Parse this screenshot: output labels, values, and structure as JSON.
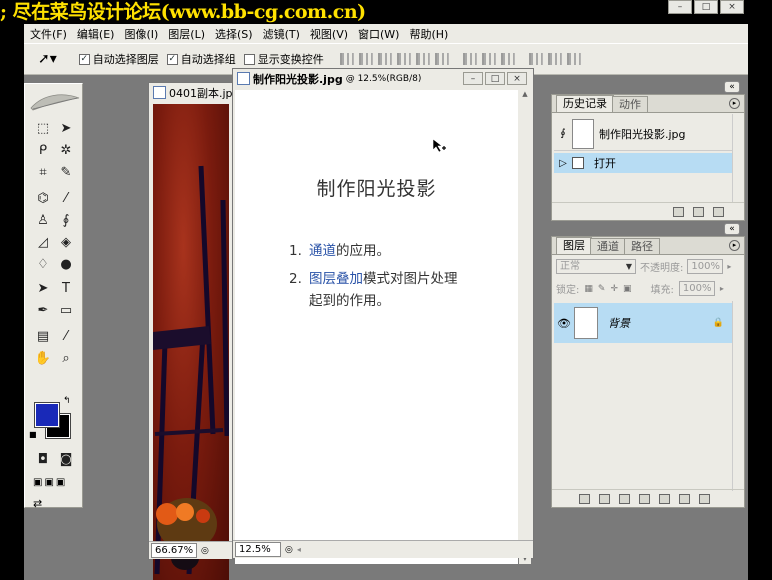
{
  "banner": {
    "text": "; 尽在菜鸟设计论坛(www.bb-cg.com.cn)"
  },
  "window_controls": [
    "–",
    "□",
    "×"
  ],
  "menu": [
    "文件(F)",
    "编辑(E)",
    "图像(I)",
    "图层(L)",
    "选择(S)",
    "滤镜(T)",
    "视图(V)",
    "窗口(W)",
    "帮助(H)"
  ],
  "options": {
    "auto_select_layer": "自动选择图层",
    "auto_select_group": "自动选择组",
    "show_transform": "显示变换控件",
    "check_mark": "✓"
  },
  "photo_window": {
    "title": "0401副本.jp",
    "zoom": "66.67%"
  },
  "text_window": {
    "title": "制作阳光投影.jpg",
    "title_suffix": "@ 12.5%(RGB/8)",
    "zoom": "12.5%",
    "heading": "制作阳光投影",
    "items": [
      {
        "num": "1.",
        "link": "通道",
        "rest": "的应用。",
        "line2": ""
      },
      {
        "num": "2.",
        "link": "图层叠加",
        "rest": "模式对图片处理",
        "line2": "起到的作用。"
      }
    ]
  },
  "history_panel": {
    "tabs": [
      "历史记录",
      "动作"
    ],
    "snapshot": "制作阳光投影.jpg",
    "step": "打开",
    "highlight": "#b7dcf3"
  },
  "layers_panel": {
    "tabs": [
      "图层",
      "通道",
      "路径"
    ],
    "blend_mode": "正常",
    "opacity_label": "不透明度:",
    "opacity_value": "100%",
    "lock_label": "锁定:",
    "fill_label": "填充:",
    "fill_value": "100%",
    "layer_name": "背景",
    "highlight": "#b7dcf3"
  },
  "colors": {
    "foreground": "#1929b8",
    "background": "#000000",
    "banner": "#ffe100"
  }
}
